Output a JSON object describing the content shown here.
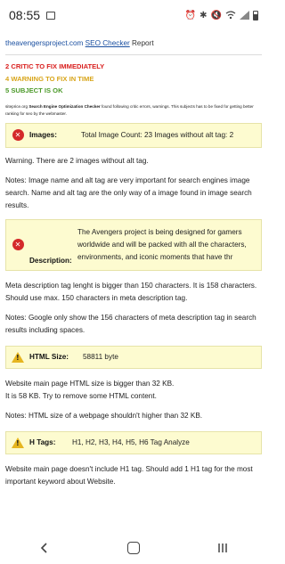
{
  "status_bar": {
    "time": "08:55",
    "icons": [
      "image-icon",
      "alarm-icon",
      "bluetooth-icon",
      "mute-icon",
      "wifi-icon",
      "signal-icon",
      "battery-icon"
    ]
  },
  "header": {
    "site": "theavengersproject.com",
    "link": "SEO Checker",
    "report": "Report"
  },
  "legend": {
    "critical": "2 CRITIC TO FIX IMMEDIATELY",
    "warning": "4 WARNING TO FIX IN TIME",
    "ok": "5 SUBJECT IS OK"
  },
  "intro": {
    "prefix": "siteprice.org",
    "bold": "Search Engine Optimization Checker",
    "rest": "found following critic errors, warnings. This subjects has to be fixed for getting better ranking for seo by the webmaster."
  },
  "sections": {
    "images": {
      "label": "Images:",
      "value": "Total Image Count: 23 Images without alt tag: 2",
      "warning": "Warning. There are 2 images without alt tag.",
      "notes": "Notes: Image name and alt tag are very important for search engines image search. Name and alt tag are the only way of a image found in image search results."
    },
    "description": {
      "label": "Description:",
      "value": "The Avengers project is being designed for gamers worldwide and will be packed with all the characters, environments, and iconic moments that have thr",
      "detail": "Meta description tag lenght is bigger than 150 characters. It is 158 characters. Should use max. 150 characters in meta description tag.",
      "notes": "Notes: Google only show the 156 characters of meta description tag in search results including spaces."
    },
    "html_size": {
      "label": "HTML Size:",
      "value": "58811 byte",
      "detail1": "Website main page HTML size is bigger than 32 KB.",
      "detail2": "It is 58 KB. Try to remove some HTML content.",
      "notes": "Notes: HTML size of a webpage shouldn't higher than 32 KB."
    },
    "h_tags": {
      "label": "H Tags:",
      "value": "H1, H2, H3, H4, H5, H6 Tag Analyze",
      "detail": "Website main page doesn't include H1 tag. Should add 1 H1 tag for the most important keyword about Website."
    }
  },
  "nav": {
    "back": "back-icon",
    "home": "home-icon",
    "recents": "recents-icon"
  }
}
